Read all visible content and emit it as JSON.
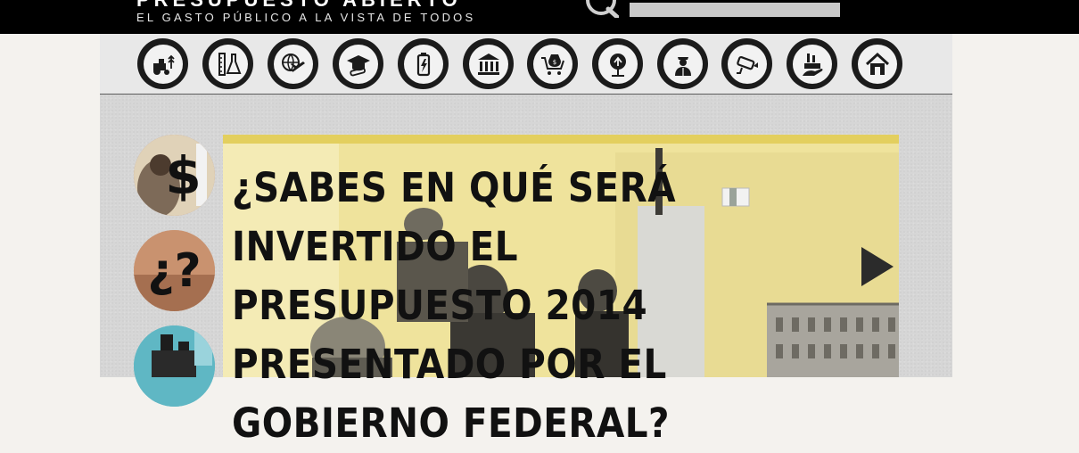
{
  "header": {
    "logo_title": "PRESUPUESTO ABIERTO",
    "tagline": "EL GASTO PÚBLICO A LA VISTA DE TODOS",
    "search": {
      "value": "",
      "placeholder": ""
    }
  },
  "categories": [
    {
      "name": "agricultura",
      "icon": "tractor-wheat-icon"
    },
    {
      "name": "ciencia",
      "icon": "ruler-flask-icon"
    },
    {
      "name": "turismo",
      "icon": "globe-plane-icon"
    },
    {
      "name": "educacion",
      "icon": "graduation-cap-icon"
    },
    {
      "name": "energia",
      "icon": "battery-bolt-icon"
    },
    {
      "name": "gobierno",
      "icon": "government-building-icon"
    },
    {
      "name": "economia",
      "icon": "money-cart-icon"
    },
    {
      "name": "medio-ambiente",
      "icon": "recycle-tree-icon"
    },
    {
      "name": "seguridad",
      "icon": "police-officer-icon"
    },
    {
      "name": "vigilancia",
      "icon": "security-camera-icon"
    },
    {
      "name": "industria",
      "icon": "factory-hand-icon"
    },
    {
      "name": "vivienda",
      "icon": "house-icon"
    }
  ],
  "hero": {
    "headline": "¿SABES EN QUÉ SERÁ INVERTIDO EL PRESUPUESTO 2014 PRESENTADO POR EL GOBIERNO FEDERAL?",
    "colors": {
      "background": "#efe39c",
      "band": "#e3cf5e",
      "text": "#111111"
    }
  },
  "thumbnails": [
    {
      "glyph": "$",
      "icon": "dollar-sign-icon",
      "bg": "#c08a6a"
    },
    {
      "glyph": "¿?",
      "icon": "question-marks-icon",
      "bg": "#d39b7c"
    },
    {
      "glyph": "",
      "icon": "business-people-icon",
      "bg": "#5fb7c4"
    }
  ]
}
